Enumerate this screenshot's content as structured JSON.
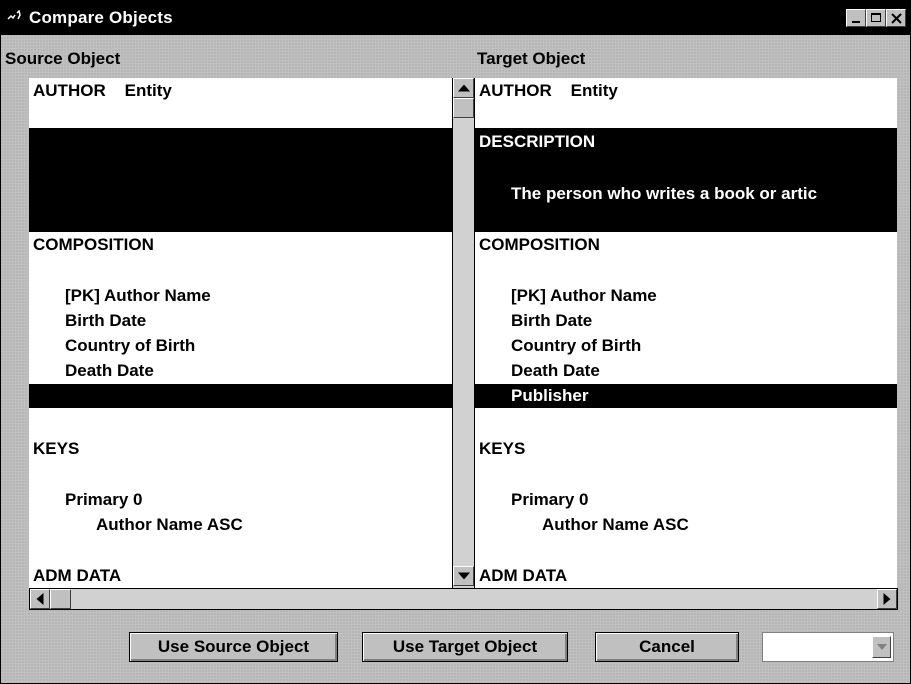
{
  "window": {
    "title": "Compare Objects"
  },
  "source": {
    "label": "Source Object",
    "header": "AUTHOR    Entity",
    "composition_heading": "COMPOSITION",
    "attributes": [
      "[PK] Author Name",
      "Birth Date",
      "Country of Birth",
      "Death Date"
    ],
    "keys_heading": "KEYS",
    "key_name": "Primary 0",
    "key_column": "Author Name ASC",
    "adm_heading": "ADM DATA"
  },
  "target": {
    "label": "Target Object",
    "header": "AUTHOR    Entity",
    "description_heading": "DESCRIPTION",
    "description_text": "The person who writes a book or artic",
    "composition_heading": "COMPOSITION",
    "attributes": [
      "[PK] Author Name",
      "Birth Date",
      "Country of Birth",
      "Death Date"
    ],
    "extra_attribute": "Publisher",
    "keys_heading": "KEYS",
    "key_name": "Primary 0",
    "key_column": "Author Name ASC",
    "adm_heading": "ADM DATA"
  },
  "buttons": {
    "use_source": "Use Source Object",
    "use_target": "Use Target Object",
    "cancel": "Cancel"
  },
  "combo": {
    "value": ""
  },
  "colors": {
    "titlebar": "#000000",
    "face": "#c0c0c0",
    "highlight": "#000000"
  }
}
